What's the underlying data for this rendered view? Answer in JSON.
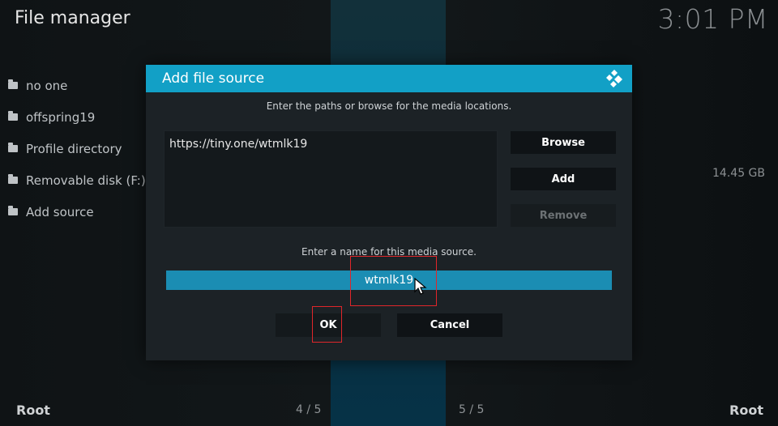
{
  "app": {
    "title": "File manager",
    "clock": "3:01 PM"
  },
  "sidebar": {
    "items": [
      {
        "label": "no one",
        "icon": "folder-icon"
      },
      {
        "label": "offspring19",
        "icon": "folder-icon"
      },
      {
        "label": "Profile directory",
        "icon": "folder-icon"
      },
      {
        "label": "Removable disk (F:)",
        "icon": "folder-icon"
      },
      {
        "label": "Add source",
        "icon": "folder-icon"
      }
    ],
    "disk_size": "14.45 GB"
  },
  "footer": {
    "left": "Root",
    "right": "Root",
    "page_left": "4 / 5",
    "page_right": "5 / 5"
  },
  "dialog": {
    "title": "Add file source",
    "instruction": "Enter the paths or browse for the media locations.",
    "paths": [
      "https://tiny.one/wtmlk19"
    ],
    "buttons": {
      "browse": "Browse",
      "add": "Add",
      "remove": "Remove"
    },
    "name_label": "Enter a name for this media source.",
    "name_value": "wtmlk19",
    "ok": "OK",
    "cancel": "Cancel"
  },
  "colors": {
    "accent": "#12a0c6",
    "highlight": "#e0262a"
  }
}
